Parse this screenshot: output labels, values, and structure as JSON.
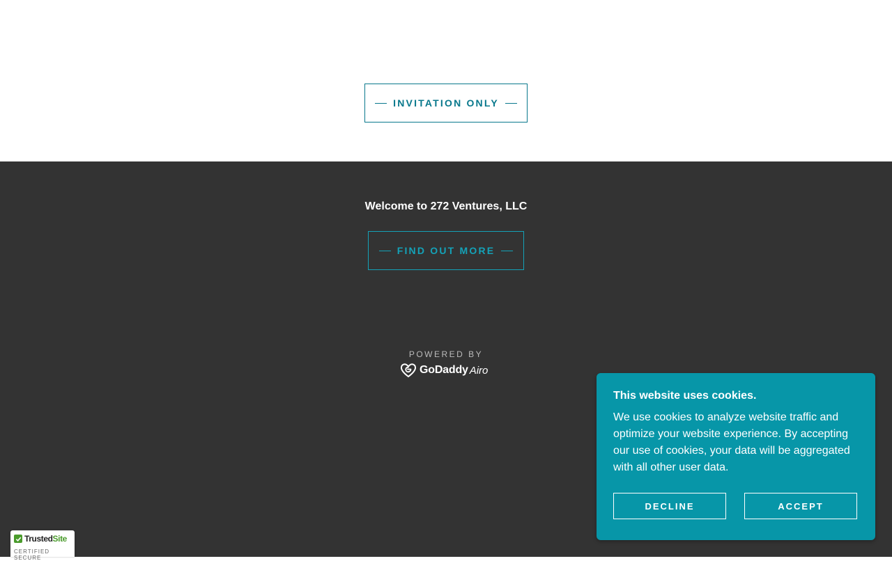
{
  "header": {
    "invite_label": "INVITATION ONLY"
  },
  "footer": {
    "welcome": "Welcome to 272 Ventures, LLC",
    "more_label": "FIND OUT MORE",
    "powered_by": "POWERED BY",
    "brand": "GoDaddy",
    "brand_suffix": "Airo"
  },
  "cookie": {
    "title": "This website uses cookies.",
    "body": "We use cookies to analyze website traffic and optimize your website experience. By accepting our use of cookies, your data will be aggregated with all other user data.",
    "decline": "DECLINE",
    "accept": "ACCEPT"
  },
  "trust_badge": {
    "name_a": "Trusted",
    "name_b": "Site",
    "tagline": "CERTIFIED SECURE"
  },
  "colors": {
    "accent": "#08788c",
    "accent_light": "#14a2b8",
    "cookie_bg": "#0796a8",
    "dark_bg": "#333333"
  }
}
